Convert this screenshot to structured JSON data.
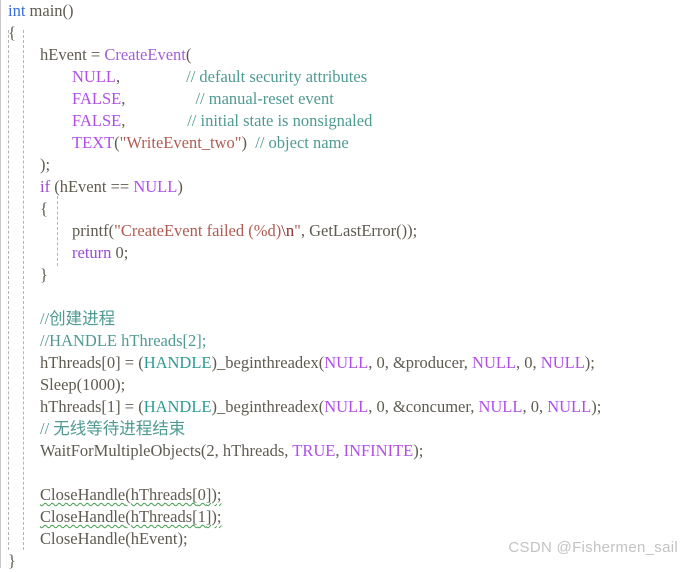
{
  "editor": {
    "language": "c",
    "background_color": "#ffffff",
    "colors": {
      "plain": "#5f5b50",
      "keyword": "#9b4dd6",
      "int_keyword": "#3b6ee0",
      "function": "#a45fd8",
      "type": "#2e9a93",
      "constant": "#b14ee8",
      "string": "#b05b52",
      "escape": "#8c2f2f",
      "comment": "#4f9a93",
      "squiggle_error": "#3f9e49",
      "indent_guide": "#b4b4b4",
      "watermark": "#c3c3c3"
    },
    "lines": [
      {
        "indent": 0,
        "tokens": [
          {
            "text": "int",
            "style": "int"
          },
          {
            "text": " ",
            "style": "plain"
          },
          {
            "text": "main",
            "style": "plain"
          },
          {
            "text": "()",
            "style": "punct"
          }
        ]
      },
      {
        "indent": 0,
        "tokens": [
          {
            "text": "{",
            "style": "punct"
          }
        ]
      },
      {
        "indent": 1,
        "tokens": [
          {
            "text": "hEvent ",
            "style": "plain"
          },
          {
            "text": "= ",
            "style": "plain"
          },
          {
            "text": "CreateEvent",
            "style": "fn"
          },
          {
            "text": "(",
            "style": "punct"
          }
        ]
      },
      {
        "indent": 2,
        "tokens": [
          {
            "text": "NULL",
            "style": "const"
          },
          {
            "text": ",",
            "style": "punct"
          },
          {
            "text": "                ",
            "style": "plain"
          },
          {
            "text": "// default security attributes",
            "style": "cmt"
          }
        ]
      },
      {
        "indent": 2,
        "tokens": [
          {
            "text": "FALSE",
            "style": "const"
          },
          {
            "text": ",",
            "style": "punct"
          },
          {
            "text": "                 ",
            "style": "plain"
          },
          {
            "text": "// manual-reset event",
            "style": "cmt"
          }
        ]
      },
      {
        "indent": 2,
        "tokens": [
          {
            "text": "FALSE",
            "style": "const"
          },
          {
            "text": ",",
            "style": "punct"
          },
          {
            "text": "               ",
            "style": "plain"
          },
          {
            "text": "// initial state is nonsignaled",
            "style": "cmt"
          }
        ]
      },
      {
        "indent": 2,
        "tokens": [
          {
            "text": "TEXT",
            "style": "const"
          },
          {
            "text": "(",
            "style": "punct"
          },
          {
            "text": "\"WriteEvent_two\"",
            "style": "str"
          },
          {
            "text": ")  ",
            "style": "punct"
          },
          {
            "text": "// object name",
            "style": "cmt"
          }
        ]
      },
      {
        "indent": 1,
        "tokens": [
          {
            "text": ");",
            "style": "punct"
          }
        ]
      },
      {
        "indent": 1,
        "tokens": [
          {
            "text": "if",
            "style": "kw"
          },
          {
            "text": " (hEvent == ",
            "style": "plain"
          },
          {
            "text": "NULL",
            "style": "const"
          },
          {
            "text": ")",
            "style": "punct"
          }
        ]
      },
      {
        "indent": 1,
        "tokens": [
          {
            "text": "{",
            "style": "punct"
          }
        ]
      },
      {
        "indent": 2,
        "tokens": [
          {
            "text": "printf",
            "style": "plain"
          },
          {
            "text": "(",
            "style": "punct"
          },
          {
            "text": "\"CreateEvent failed (%d)",
            "style": "str"
          },
          {
            "text": "\\n",
            "style": "esc"
          },
          {
            "text": "\"",
            "style": "str"
          },
          {
            "text": ", ",
            "style": "punct"
          },
          {
            "text": "GetLastError",
            "style": "plain"
          },
          {
            "text": "());",
            "style": "punct"
          }
        ]
      },
      {
        "indent": 2,
        "tokens": [
          {
            "text": "return",
            "style": "kw"
          },
          {
            "text": " ",
            "style": "plain"
          },
          {
            "text": "0",
            "style": "num"
          },
          {
            "text": ";",
            "style": "punct"
          }
        ]
      },
      {
        "indent": 1,
        "tokens": [
          {
            "text": "}",
            "style": "punct"
          }
        ]
      },
      {
        "indent": 0,
        "tokens": []
      },
      {
        "indent": 1,
        "tokens": [
          {
            "text": "//创建进程",
            "style": "cmt"
          }
        ]
      },
      {
        "indent": 1,
        "tokens": [
          {
            "text": "//HANDLE hThreads[2];",
            "style": "cmt"
          }
        ]
      },
      {
        "indent": 1,
        "tokens": [
          {
            "text": "hThreads[",
            "style": "plain"
          },
          {
            "text": "0",
            "style": "num"
          },
          {
            "text": "] = (",
            "style": "plain"
          },
          {
            "text": "HANDLE",
            "style": "type"
          },
          {
            "text": ")_beginthreadex(",
            "style": "plain"
          },
          {
            "text": "NULL",
            "style": "const"
          },
          {
            "text": ", ",
            "style": "punct"
          },
          {
            "text": "0",
            "style": "num"
          },
          {
            "text": ", &producer, ",
            "style": "plain"
          },
          {
            "text": "NULL",
            "style": "const"
          },
          {
            "text": ", ",
            "style": "punct"
          },
          {
            "text": "0",
            "style": "num"
          },
          {
            "text": ", ",
            "style": "punct"
          },
          {
            "text": "NULL",
            "style": "const"
          },
          {
            "text": ");",
            "style": "punct"
          }
        ]
      },
      {
        "indent": 1,
        "tokens": [
          {
            "text": "Sleep",
            "style": "plain"
          },
          {
            "text": "(",
            "style": "punct"
          },
          {
            "text": "1000",
            "style": "num"
          },
          {
            "text": ");",
            "style": "punct"
          }
        ]
      },
      {
        "indent": 1,
        "tokens": [
          {
            "text": "hThreads[",
            "style": "plain"
          },
          {
            "text": "1",
            "style": "num"
          },
          {
            "text": "] = (",
            "style": "plain"
          },
          {
            "text": "HANDLE",
            "style": "type"
          },
          {
            "text": ")_beginthreadex(",
            "style": "plain"
          },
          {
            "text": "NULL",
            "style": "const"
          },
          {
            "text": ", ",
            "style": "punct"
          },
          {
            "text": "0",
            "style": "num"
          },
          {
            "text": ", &concumer, ",
            "style": "plain"
          },
          {
            "text": "NULL",
            "style": "const"
          },
          {
            "text": ", ",
            "style": "punct"
          },
          {
            "text": "0",
            "style": "num"
          },
          {
            "text": ", ",
            "style": "punct"
          },
          {
            "text": "NULL",
            "style": "const"
          },
          {
            "text": ");",
            "style": "punct"
          }
        ]
      },
      {
        "indent": 1,
        "tokens": [
          {
            "text": "// 无线等待进程结束",
            "style": "cmt"
          }
        ]
      },
      {
        "indent": 1,
        "tokens": [
          {
            "text": "WaitForMultipleObjects",
            "style": "plain"
          },
          {
            "text": "(",
            "style": "punct"
          },
          {
            "text": "2",
            "style": "num"
          },
          {
            "text": ", hThreads, ",
            "style": "plain"
          },
          {
            "text": "TRUE",
            "style": "const"
          },
          {
            "text": ", ",
            "style": "punct"
          },
          {
            "text": "INFINITE",
            "style": "const"
          },
          {
            "text": ");",
            "style": "punct"
          }
        ]
      },
      {
        "indent": 0,
        "tokens": []
      },
      {
        "indent": 1,
        "squiggle": true,
        "tokens": [
          {
            "text": "CloseHandle",
            "style": "plain"
          },
          {
            "text": "(hThreads[",
            "style": "plain"
          },
          {
            "text": "0",
            "style": "num"
          },
          {
            "text": "])",
            "style": "plain"
          },
          {
            "text": ";",
            "style": "punct",
            "no_squiggle": true
          }
        ]
      },
      {
        "indent": 1,
        "squiggle": true,
        "tokens": [
          {
            "text": "CloseHandle",
            "style": "plain"
          },
          {
            "text": "(hThreads[",
            "style": "plain"
          },
          {
            "text": "1",
            "style": "num"
          },
          {
            "text": "])",
            "style": "plain"
          },
          {
            "text": ";",
            "style": "punct",
            "no_squiggle": true
          }
        ]
      },
      {
        "indent": 1,
        "tokens": [
          {
            "text": "CloseHandle",
            "style": "plain"
          },
          {
            "text": "(hEvent);",
            "style": "plain"
          }
        ]
      },
      {
        "indent": 0,
        "tokens": [
          {
            "text": "}",
            "style": "punct"
          }
        ]
      }
    ]
  },
  "watermark": {
    "text": "CSDN @Fishermen_sail"
  }
}
